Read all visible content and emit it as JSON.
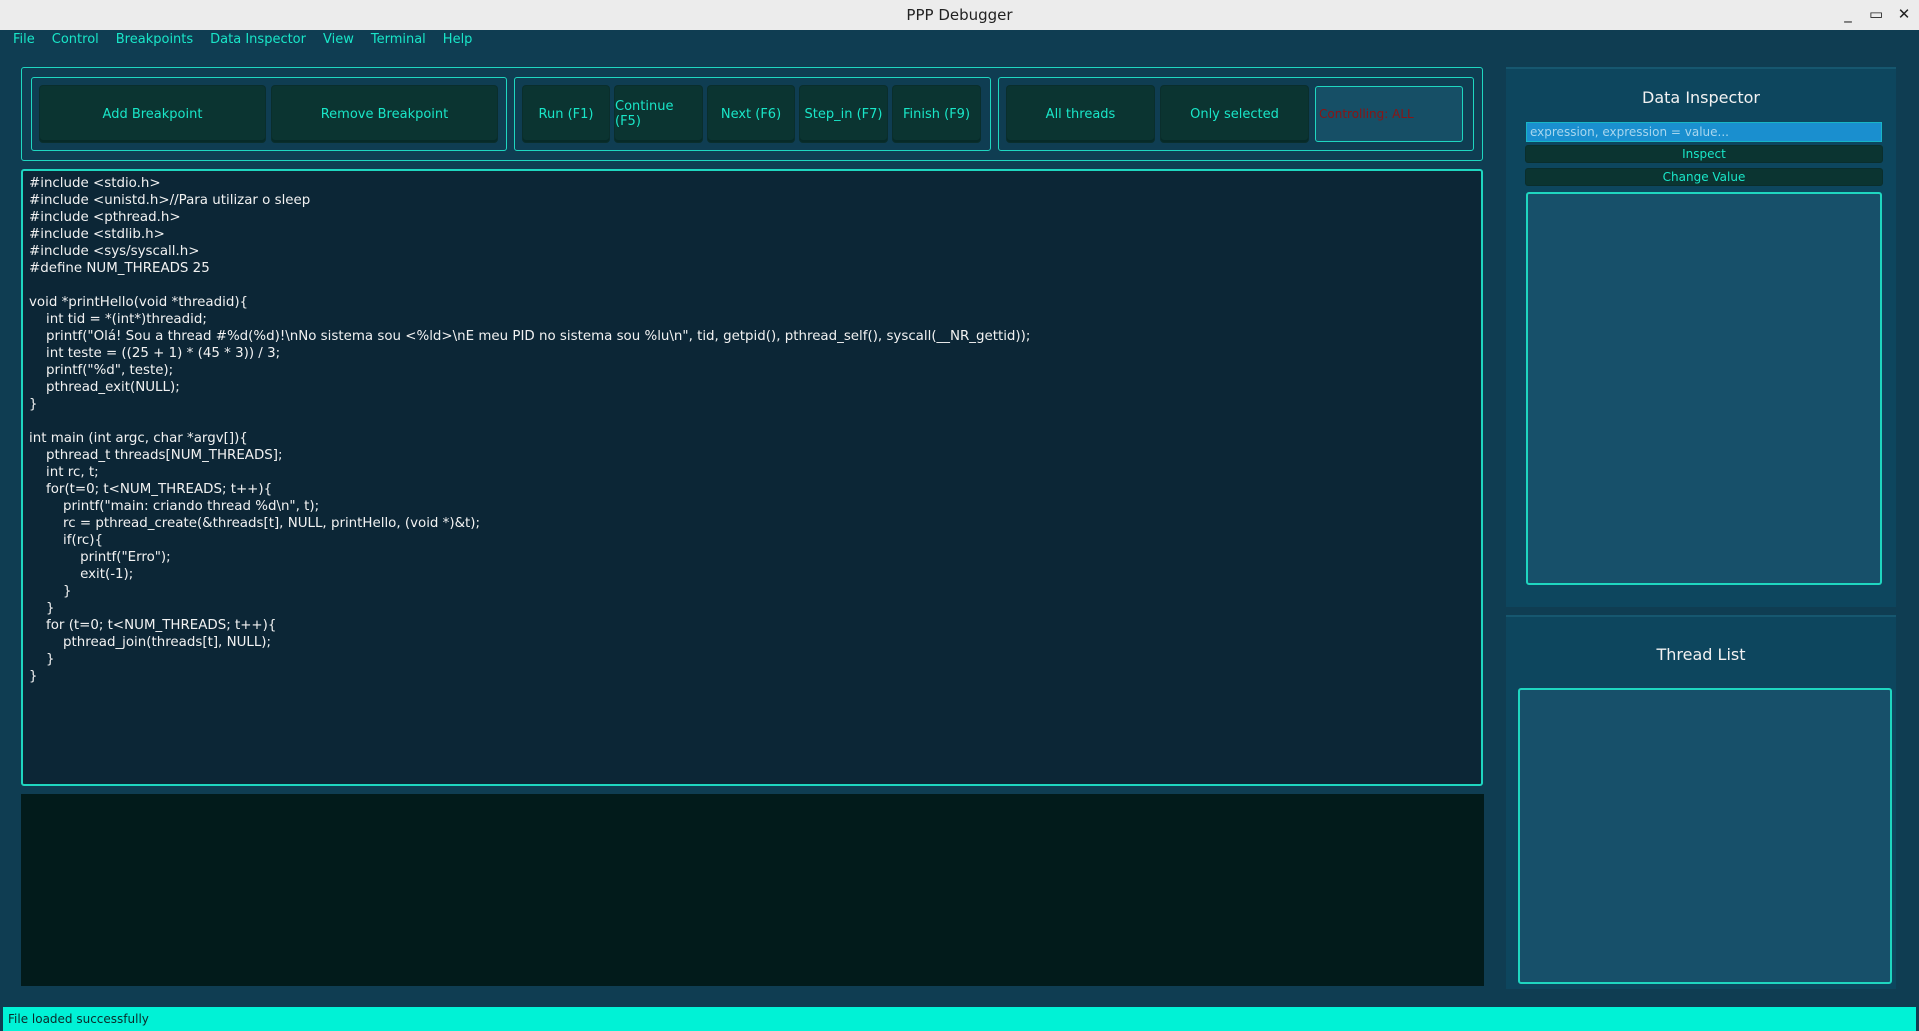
{
  "window": {
    "title": "PPP Debugger",
    "controls": [
      "_",
      "▭",
      "✕"
    ]
  },
  "menu": [
    "File",
    "Control",
    "Breakpoints",
    "Data Inspector",
    "View",
    "Terminal",
    "Help"
  ],
  "toolbar": {
    "breakpoints": {
      "add": "Add Breakpoint",
      "remove": "Remove Breakpoint"
    },
    "execution": {
      "run": "Run (F1)",
      "continue": "Continue (F5)",
      "next": "Next (F6)",
      "step_in": "Step_in (F7)",
      "finish": "Finish (F9)"
    },
    "threads": {
      "all": "All threads",
      "selected": "Only selected",
      "controlling": "Controlling: ALL"
    }
  },
  "editor": {
    "code": "#include <stdio.h>\n#include <unistd.h>//Para utilizar o sleep\n#include <pthread.h>\n#include <stdlib.h>\n#include <sys/syscall.h>\n#define NUM_THREADS 25\n\nvoid *printHello(void *threadid){\n    int tid = *(int*)threadid;\n    printf(\"Olá! Sou a thread #%d(%d)!\\nNo sistema sou <%ld>\\nE meu PID no sistema sou %lu\\n\", tid, getpid(), pthread_self(), syscall(__NR_gettid));\n    int teste = ((25 + 1) * (45 * 3)) / 3;\n    printf(\"%d\", teste);\n    pthread_exit(NULL);\n}\n\nint main (int argc, char *argv[]){\n    pthread_t threads[NUM_THREADS];\n    int rc, t;\n    for(t=0; t<NUM_THREADS; t++){\n        printf(\"main: criando thread %d\\n\", t);\n        rc = pthread_create(&threads[t], NULL, printHello, (void *)&t);\n        if(rc){\n            printf(\"Erro\");\n            exit(-1);\n        }\n    }\n    for (t=0; t<NUM_THREADS; t++){\n        pthread_join(threads[t], NULL);\n    }\n}"
  },
  "inspector": {
    "title": "Data Inspector",
    "placeholder": "expression, expression = value...",
    "inspect_label": "Inspect",
    "change_label": "Change Value"
  },
  "thread_list": {
    "title": "Thread List"
  },
  "status": {
    "message": "File loaded successfully"
  },
  "colors": {
    "accent": "#1fd6c0",
    "text_accent": "#19e6c8",
    "background": "#0f3d52",
    "status_bar": "#00f2d6",
    "controlling_text": "#8b1414"
  }
}
